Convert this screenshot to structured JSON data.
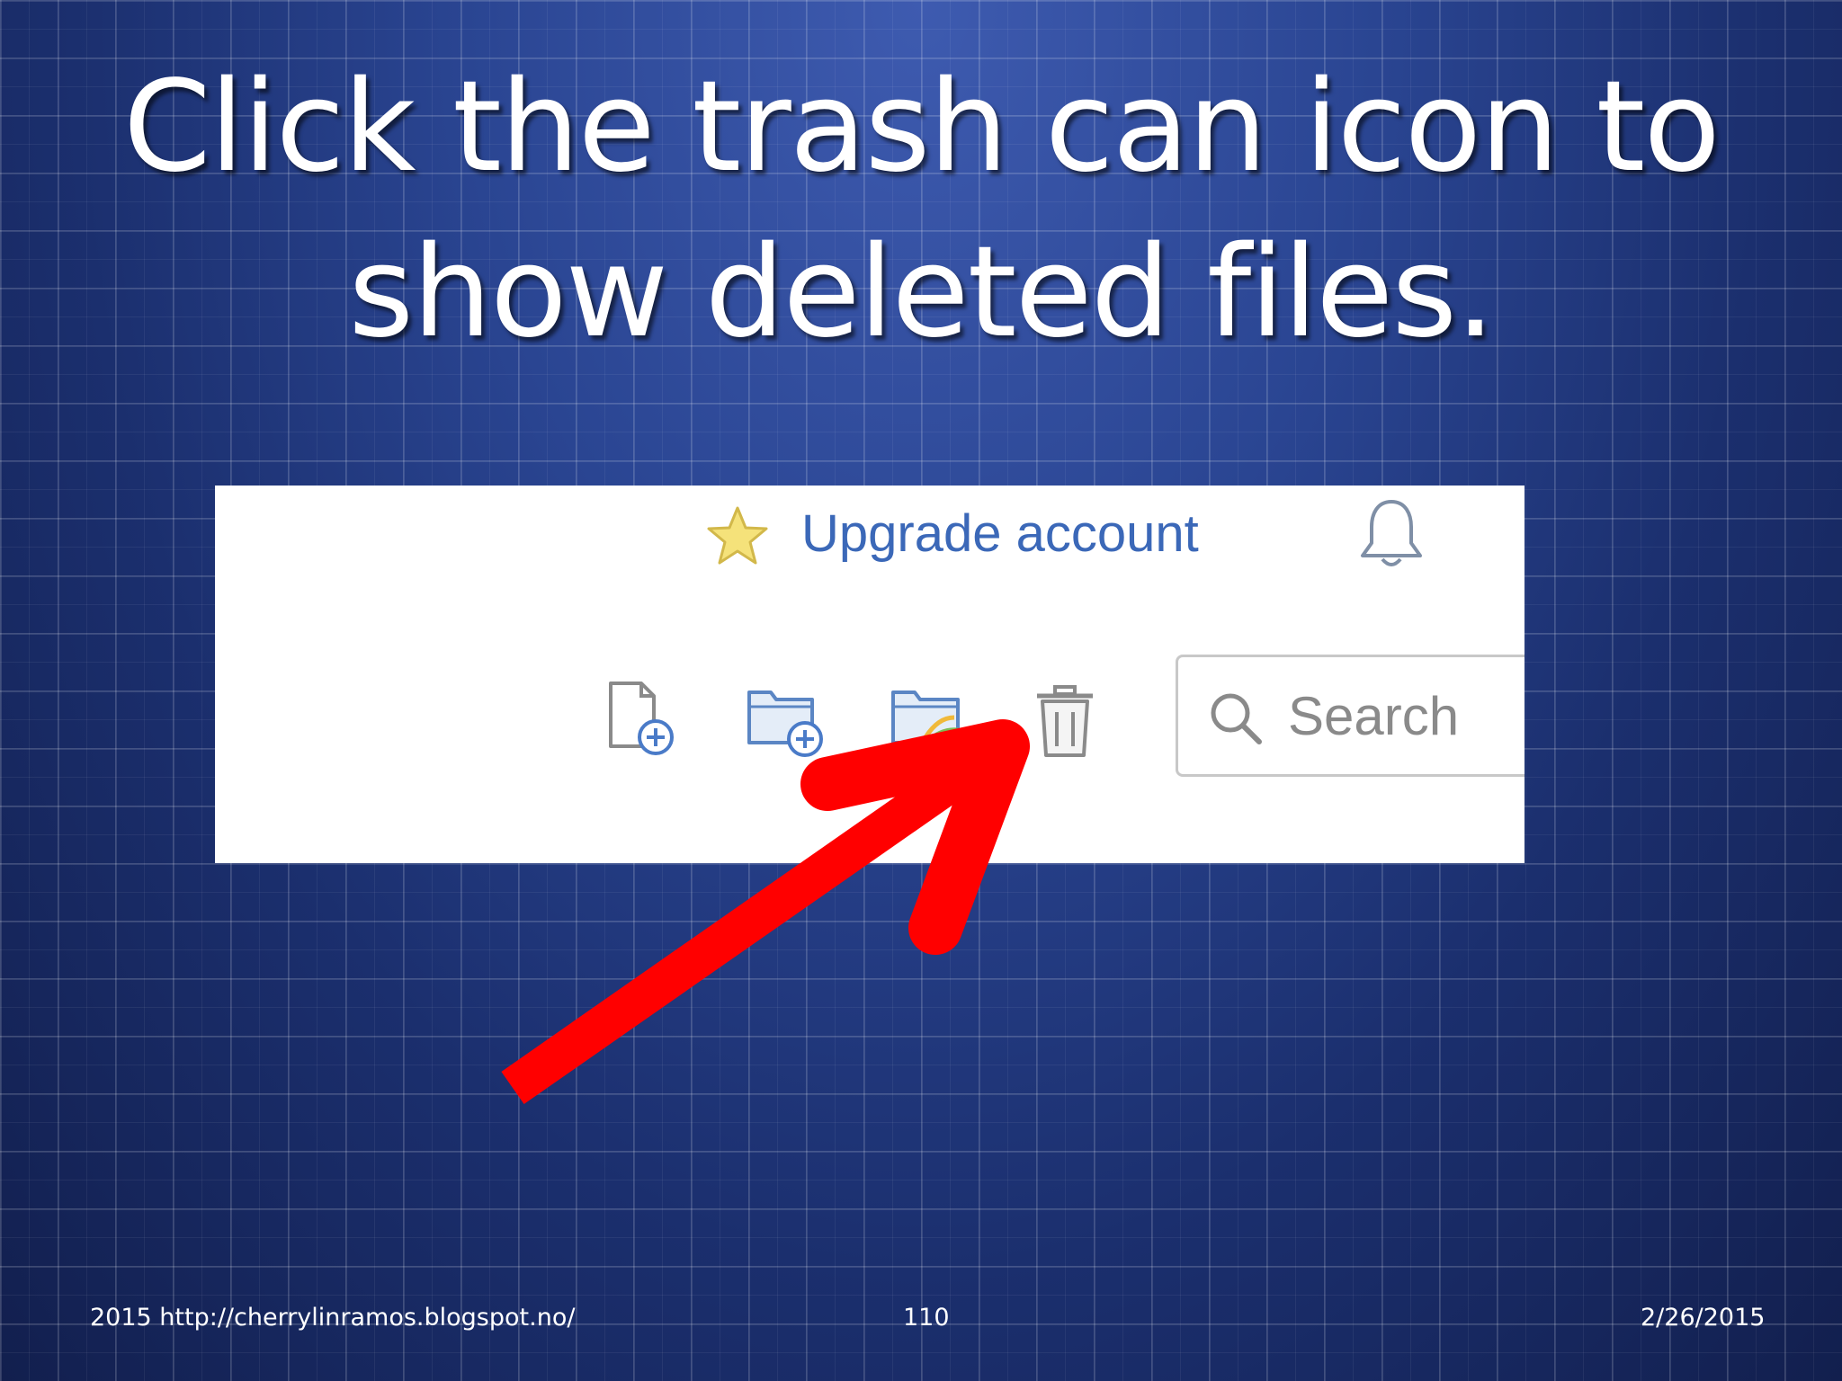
{
  "slide": {
    "title_line1": "Click the trash can icon to",
    "title_line2": "show deleted files."
  },
  "screenshot": {
    "header": {
      "upgrade_label": "Upgrade account",
      "star_icon": "star-icon",
      "bell_icon": "bell-icon"
    },
    "toolbar": {
      "icons": [
        "new-file-icon",
        "new-folder-icon",
        "shared-folder-icon",
        "trash-icon"
      ]
    },
    "search": {
      "placeholder": "Search"
    }
  },
  "footer": {
    "left": "2015 http://cherrylinramos.blogspot.no/",
    "page_number": "110",
    "date": "2/26/2015"
  },
  "colors": {
    "accent_link": "#3b68b8",
    "arrow": "#ff0000",
    "star_fill": "#f5e27a"
  }
}
